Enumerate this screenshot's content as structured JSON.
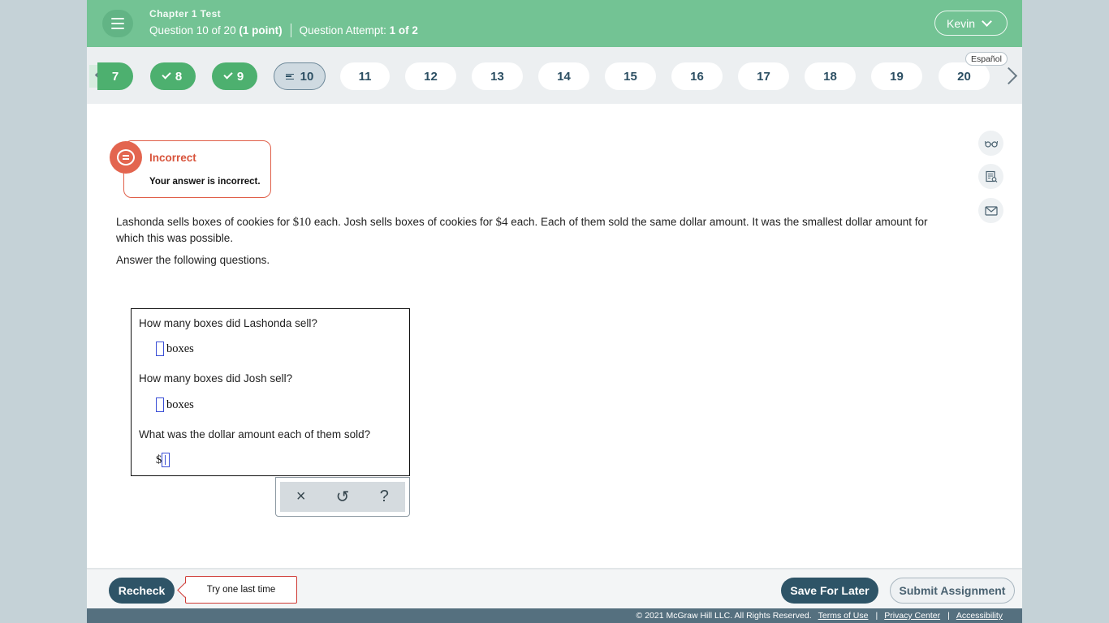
{
  "header": {
    "chapter": "Chapter 1 Test",
    "question_label": "Question 10 of 20",
    "points": "(1 point)",
    "attempt_label": "Question Attempt:",
    "attempt_value": "1 of 2",
    "user": "Kevin"
  },
  "nav": {
    "espanol": "Español",
    "questions": [
      {
        "num": "7",
        "status": "correct"
      },
      {
        "num": "8",
        "status": "correct"
      },
      {
        "num": "9",
        "status": "correct"
      },
      {
        "num": "10",
        "status": "current"
      },
      {
        "num": "11",
        "status": "unanswered"
      },
      {
        "num": "12",
        "status": "unanswered"
      },
      {
        "num": "13",
        "status": "unanswered"
      },
      {
        "num": "14",
        "status": "unanswered"
      },
      {
        "num": "15",
        "status": "unanswered"
      },
      {
        "num": "16",
        "status": "unanswered"
      },
      {
        "num": "17",
        "status": "unanswered"
      },
      {
        "num": "18",
        "status": "unanswered"
      },
      {
        "num": "19",
        "status": "unanswered"
      },
      {
        "num": "20",
        "status": "unanswered"
      }
    ]
  },
  "feedback": {
    "title": "Incorrect",
    "message": "Your answer is incorrect."
  },
  "question": {
    "part1": "Lashonda sells boxes of cookies for ",
    "price1": "$10",
    "part2": " each. Josh sells boxes of cookies for ",
    "price2": "$4",
    "part3": " each. Each of them sold the same dollar amount. It was the smallest dollar amount for which this was possible.",
    "instruction": "Answer the following questions."
  },
  "answers": {
    "q1": "How many boxes did Lashonda sell?",
    "q1_unit": "boxes",
    "q2": "How many boxes did Josh sell?",
    "q2_unit": "boxes",
    "q3": "What was the dollar amount each of them sold?",
    "q3_prefix": "$"
  },
  "math_tools": {
    "clear": "×",
    "undo": "↺",
    "help": "?"
  },
  "footer": {
    "recheck": "Recheck",
    "tip": "Try one last time",
    "save": "Save For Later",
    "submit": "Submit Assignment"
  },
  "legal": {
    "copyright": "© 2021 McGraw Hill LLC. All Rights Reserved.",
    "terms": "Terms of Use",
    "privacy": "Privacy Center",
    "accessibility": "Accessibility"
  },
  "colors": {
    "header_green": "#73c394",
    "done_green": "#4db06f",
    "navy": "#2e5467",
    "incorrect_red": "#e3654f"
  }
}
